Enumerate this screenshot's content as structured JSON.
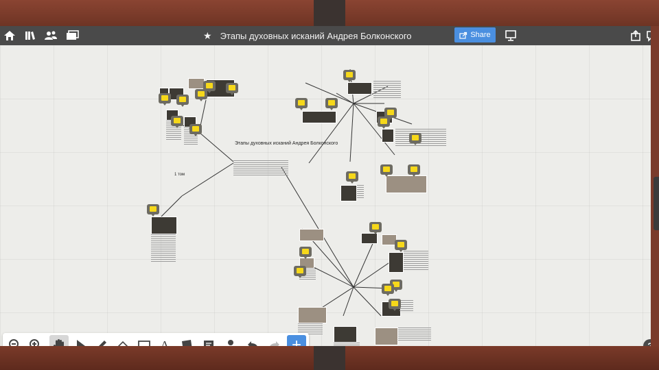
{
  "topbar": {
    "title": "Этапы духовных исканий Андрея Болконского",
    "share_label": "Share",
    "icons": [
      "home-icon",
      "library-icon",
      "users-icon",
      "gallery-icon",
      "star-icon",
      "share-icon",
      "present-icon",
      "export-icon",
      "comment-icon"
    ]
  },
  "canvas": {
    "central_topic": "Этапы духовных исканий Андрея Болконского",
    "branch_label": "1 том"
  },
  "toolbar": {
    "tools": [
      "zoom-out",
      "zoom-in",
      "pan",
      "select",
      "pen",
      "eraser",
      "rectangle",
      "text",
      "shape",
      "comment",
      "user",
      "undo",
      "redo",
      "add"
    ],
    "add_label": "+",
    "text_tool_label": "A"
  },
  "help_label": "?"
}
